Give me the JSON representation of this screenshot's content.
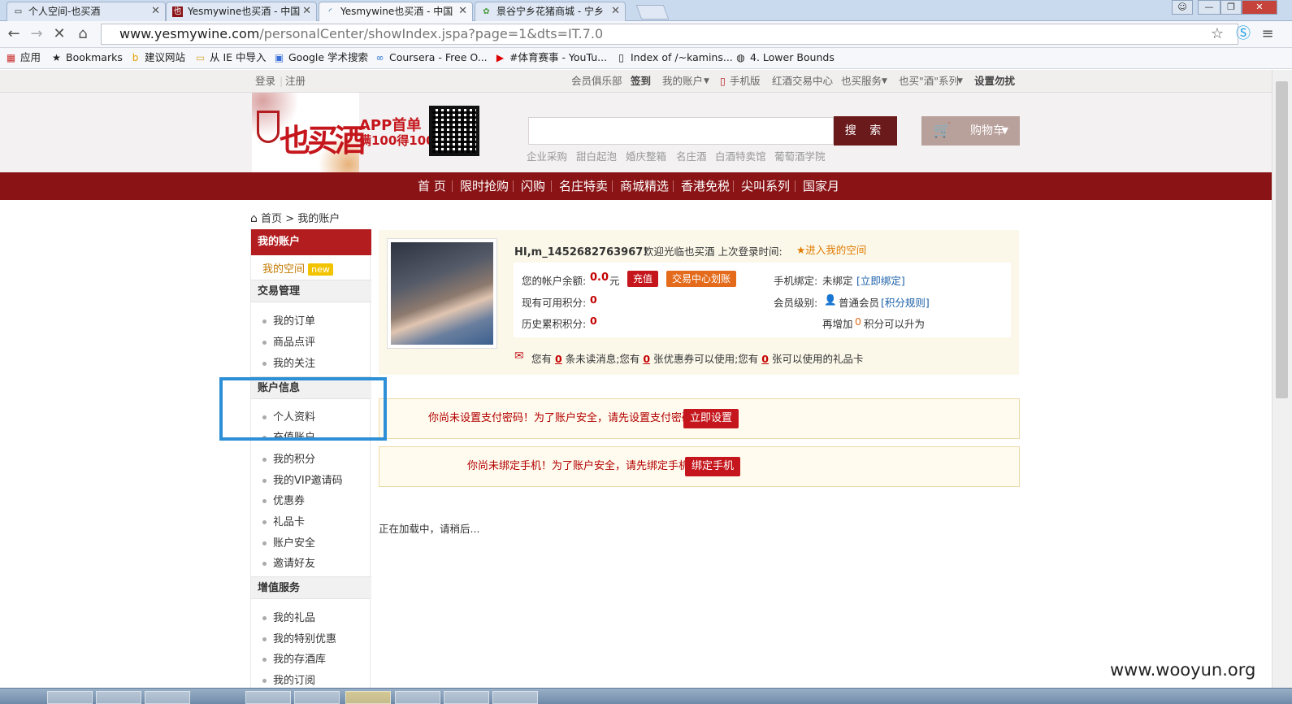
{
  "browser": {
    "tabs": [
      {
        "title": "个人空间-也买酒"
      },
      {
        "title": "Yesmywine也买酒 - 中国"
      },
      {
        "title": "Yesmywine也买酒 - 中国"
      },
      {
        "title": "景谷宁乡花猪商城 - 宁乡"
      }
    ],
    "url_host": "www.yesmywine.com",
    "url_path": "/personalCenter/showIndex.jspa?page=1&dts=IT.7.0",
    "bookmarks": [
      {
        "label": "应用",
        "icon": "apps-icon"
      },
      {
        "label": "Bookmarks",
        "icon": "star-icon"
      },
      {
        "label": "建议网站",
        "icon": "bing-icon"
      },
      {
        "label": "从 IE 中导入",
        "icon": "folder-icon"
      },
      {
        "label": "Google 学术搜索",
        "icon": "scholar-icon"
      },
      {
        "label": "Coursera - Free O...",
        "icon": "coursera-icon"
      },
      {
        "label": "#体育赛事 - YouTu...",
        "icon": "youtube-icon"
      },
      {
        "label": "Index of /~kamins...",
        "icon": "page-icon"
      },
      {
        "label": "4. Lower Bounds",
        "icon": "globe-icon"
      }
    ]
  },
  "site": {
    "top_left": {
      "login": "登录",
      "register": "注册"
    },
    "top_links": [
      "会员俱乐部",
      "签到",
      "我的账户",
      "手机版",
      "红酒交易中心",
      "也买服务",
      "也买\"酒\"系列",
      "设置勿扰"
    ],
    "search_button": "搜 索",
    "cart_button": "购物车",
    "hot_links": [
      "企业采购",
      "甜白起泡",
      "婚庆整箱",
      "名庄酒",
      "白酒特卖馆",
      "葡萄酒学院"
    ],
    "promo": {
      "line1": "APP首单",
      "line2": "满100得100"
    },
    "logo_text": "也买酒",
    "main_nav": [
      "首 页",
      "限时抢购",
      "闪购",
      "名庄特卖",
      "商城精选",
      "香港免税",
      "尖叫系列",
      "国家月"
    ]
  },
  "breadcrumb": {
    "home": "首页",
    "sep": ">",
    "current": "我的账户"
  },
  "sidebar": {
    "header": "我的账户",
    "space": "我的空间",
    "new_badge": "new",
    "sections": [
      {
        "title": "交易管理",
        "items": [
          "我的订单",
          "商品点评",
          "我的关注"
        ]
      },
      {
        "title": "账户信息",
        "items": [
          "个人资料",
          "充值账户",
          "我的积分",
          "我的VIP邀请码",
          "优惠券",
          "礼品卡",
          "账户安全",
          "邀请好友"
        ]
      },
      {
        "title": "增值服务",
        "items": [
          "我的礼品",
          "我的特别优惠",
          "我的存酒库",
          "我的订阅"
        ]
      }
    ]
  },
  "profile": {
    "greeting_user": "HI,m_1452682763967！",
    "greeting_rest": "欢迎光临也买酒 上次登录时间:",
    "enter_space": "进入我的空间",
    "balance_label": "您的帐户余额:",
    "balance_value": "0.0",
    "balance_unit": "元",
    "recharge_button": "充值",
    "transfer_button": "交易中心划账",
    "points_label": "现有可用积分:",
    "points_value": "0",
    "history_label": "历史累积积分:",
    "history_value": "0",
    "phone_label": "手机绑定:",
    "phone_status": "未绑定",
    "phone_bind_link": "[立即绑定]",
    "level_label": "会员级别:",
    "level_value": "普通会员",
    "level_rules_link": "[积分规则]",
    "upgrade_prefix": "再增加",
    "upgrade_value": "0",
    "upgrade_suffix": "积分可以升为",
    "msg_1": "您有",
    "msg_unread": "0",
    "msg_2": "条未读消息;您有",
    "msg_coupons": "0",
    "msg_3": "张优惠券可以使用;您有",
    "msg_cards": "0",
    "msg_4": "张可以使用的礼品卡"
  },
  "alerts": [
    {
      "text": "你尚未设置支付密码！为了账户安全，请先设置支付密码",
      "button": "立即设置"
    },
    {
      "text": "你尚未绑定手机！为了账户安全，请先绑定手机",
      "button": "绑定手机"
    }
  ],
  "loading_text": "正在加载中，请稍后...",
  "watermark": "www.wooyun.org",
  "colors": {
    "brand_red": "#8a1316",
    "sidebar_red": "#b31d1f",
    "button_red": "#c4161c",
    "highlight_blue": "#2d8fd6"
  }
}
